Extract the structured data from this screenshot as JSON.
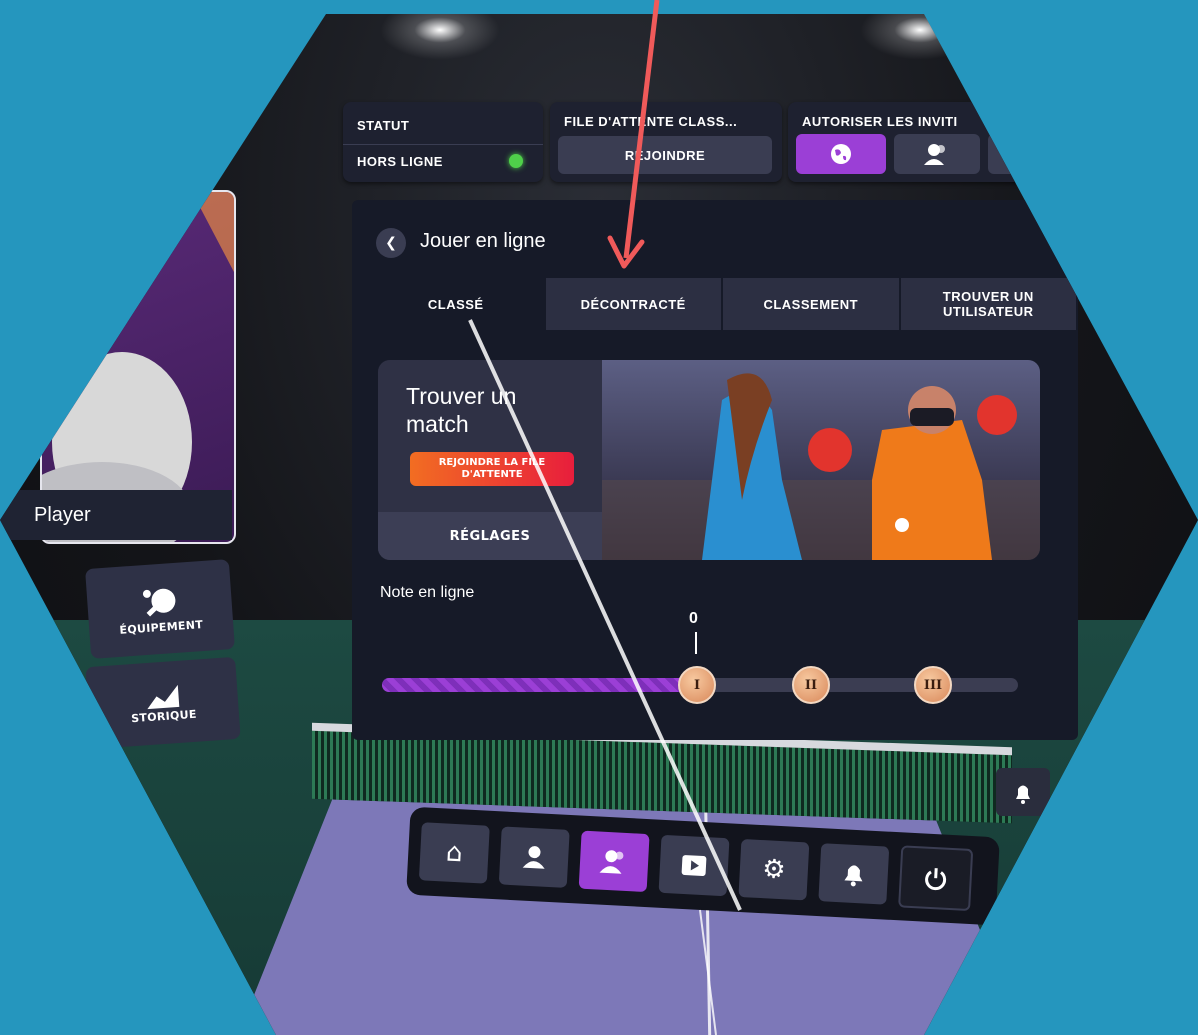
{
  "status": {
    "title": "STATUT",
    "value": "HORS LIGNE"
  },
  "queue": {
    "title": "FILE D'ATTENTE CLASS...",
    "join_label": "REJOINDRE"
  },
  "invites": {
    "title": "AUTORISER LES INVITI"
  },
  "main": {
    "title": "Jouer en ligne",
    "tabs": [
      "CLASSÉ",
      "DÉCONTRACTÉ",
      "CLASSEMENT",
      "TROUVER UN UTILISATEUR"
    ],
    "active_tab": "CLASSÉ",
    "find_match": {
      "title": "Trouver un match",
      "join_label": "REJOINDRE LA FILE D'ATTENTE",
      "settings_label": "RÉGLAGES"
    },
    "rating": {
      "label": "Note en ligne",
      "value": "0",
      "progress_fraction": 0.49,
      "tiers": [
        "I",
        "II",
        "III"
      ]
    }
  },
  "profile": {
    "player_name": "Player"
  },
  "sidebar": {
    "equipment": "ÉQUIPEMENT",
    "history": "STORIQUE"
  },
  "colors": {
    "accent": "#9b3fd6",
    "status_online": "#4fcf4a",
    "cta_start": "#f26d22",
    "cta_end": "#e81e3c",
    "annotation": "#f05a5a"
  },
  "toolbar": {
    "icons": [
      "home-icon",
      "person-icon",
      "friends-icon",
      "video-play-icon",
      "gear-icon",
      "bell-icon",
      "power-icon"
    ],
    "active": "friends-icon"
  }
}
